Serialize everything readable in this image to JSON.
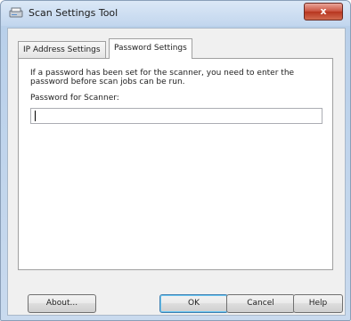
{
  "window": {
    "title": "Scan Settings Tool",
    "close_symbol": "x"
  },
  "tabs": [
    {
      "label": "IP Address Settings",
      "active": false
    },
    {
      "label": "Password Settings",
      "active": true
    }
  ],
  "password_tab": {
    "description": "If a password has been set for the scanner, you need to enter the password before scan jobs can be run.",
    "field_label": "Password for Scanner:",
    "field_value": ""
  },
  "buttons": {
    "about": "About...",
    "ok": "OK",
    "cancel": "Cancel",
    "help": "Help"
  },
  "colors": {
    "accent": "#3c7fb1",
    "close": "#c9503c"
  }
}
